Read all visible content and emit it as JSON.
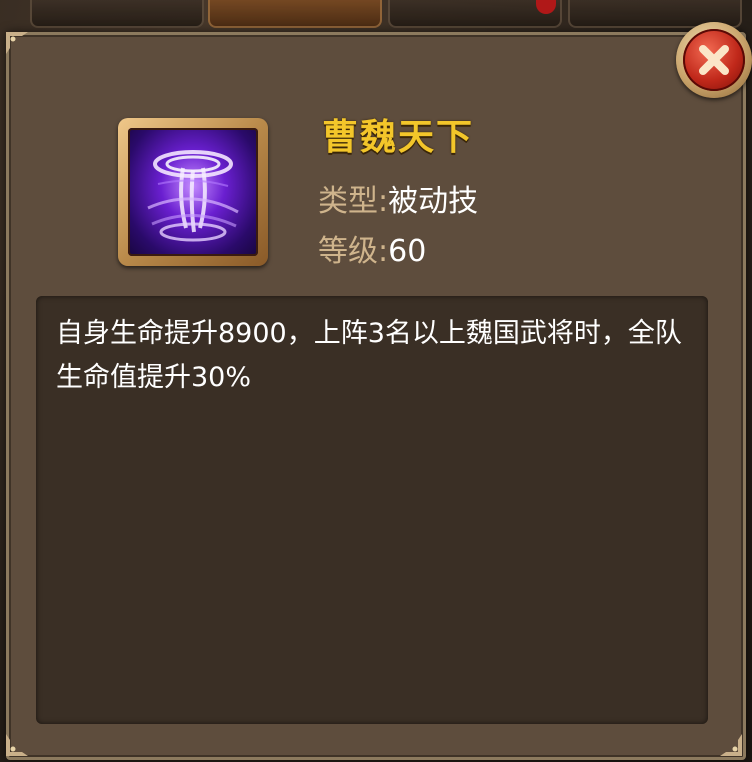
{
  "skill": {
    "name": "曹魏天下",
    "type_label": "类型:",
    "type_value": "被动技",
    "level_label": "等级:",
    "level_value": "60",
    "description": "自身生命提升8900，上阵3名以上魏国武将时，全队生命值提升30%",
    "icon": "purple-tornado-skill-icon"
  },
  "close_button": {
    "icon": "close-x-icon"
  },
  "colors": {
    "skill_name": "#f3c62a",
    "label": "#cfb48c",
    "value": "#ffffff",
    "panel": "#5e4d3d",
    "description_box": "#3a2f25",
    "close_button": "#c0281a"
  }
}
